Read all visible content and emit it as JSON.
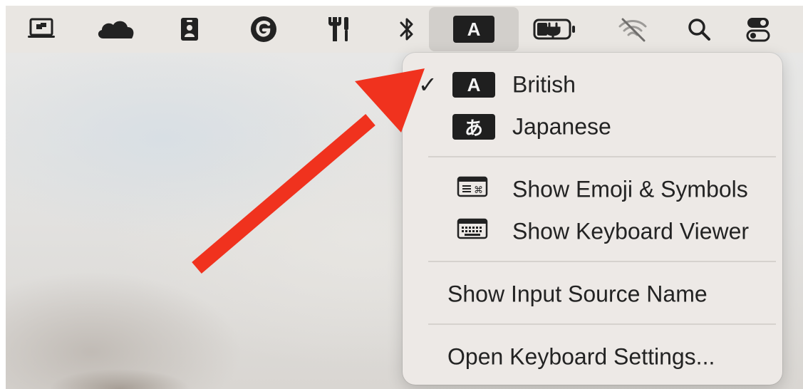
{
  "menubar": {
    "icons": [
      {
        "name": "screen-share-icon"
      },
      {
        "name": "onedrive-cloud-icon"
      },
      {
        "name": "id-badge-icon"
      },
      {
        "name": "grammarly-icon"
      },
      {
        "name": "tools-icon"
      },
      {
        "name": "bluetooth-icon"
      },
      {
        "name": "input-source-icon",
        "label": "A",
        "active": true
      },
      {
        "name": "battery-charging-icon"
      },
      {
        "name": "wifi-off-icon"
      },
      {
        "name": "spotlight-search-icon"
      },
      {
        "name": "control-center-icon"
      }
    ]
  },
  "menu": {
    "sources": [
      {
        "badge": "A",
        "label": "British",
        "checked": true,
        "check_mark": "✓"
      },
      {
        "badge": "あ",
        "label": "Japanese",
        "checked": false
      }
    ],
    "actions": [
      {
        "label": "Show Emoji & Symbols",
        "icon": "emoji-symbols-icon"
      },
      {
        "label": "Show Keyboard Viewer",
        "icon": "keyboard-viewer-icon"
      }
    ],
    "show_input_source_name": "Show Input Source Name",
    "open_keyboard_settings": "Open Keyboard Settings..."
  },
  "colors": {
    "menubar_bg": "#e9e6e2",
    "menu_bg": "#ede9e6",
    "arrow": "#f0321e",
    "badge_bg": "#1f1f1f"
  }
}
